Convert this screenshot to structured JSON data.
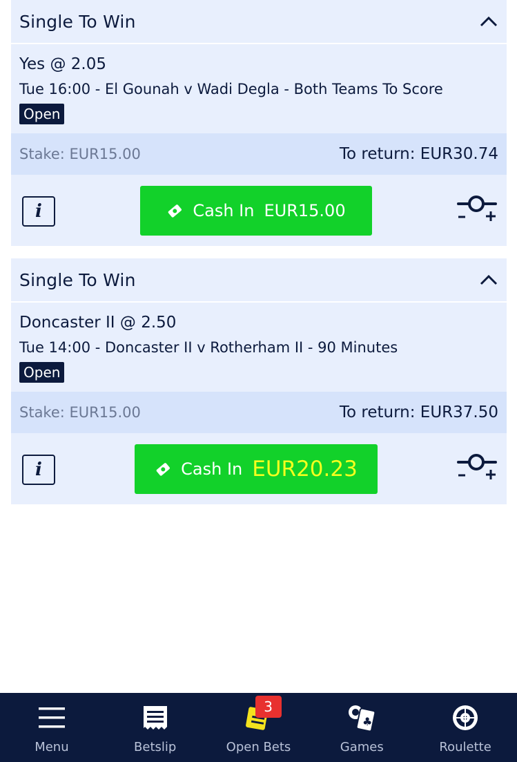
{
  "bets": [
    {
      "title": "Single To Win",
      "selection": "Yes @ 2.05",
      "event": "Tue 16:00 - El Gounah v Wadi Degla - Both Teams To Score",
      "status": "Open",
      "stake": "Stake: EUR15.00",
      "to_return": "To return: EUR30.74",
      "cash_in_label": "Cash In",
      "cash_in_amount": "EUR15.00"
    },
    {
      "title": "Single To Win",
      "selection": "Doncaster II @ 2.50",
      "event": "Tue 14:00 - Doncaster II v Rotherham II - 90 Minutes",
      "status": "Open",
      "stake": "Stake: EUR15.00",
      "to_return": "To return: EUR37.50",
      "cash_in_label": "Cash In",
      "cash_in_amount": "EUR20.23"
    }
  ],
  "info_label": "i",
  "nav": {
    "items": [
      {
        "label": "Menu",
        "icon": "hamburger-icon"
      },
      {
        "label": "Betslip",
        "icon": "receipt-icon"
      },
      {
        "label": "Open Bets",
        "icon": "open-bets-icon",
        "badge": "3"
      },
      {
        "label": "Games",
        "icon": "cards-icon"
      },
      {
        "label": "Roulette",
        "icon": "roulette-icon"
      }
    ]
  },
  "colors": {
    "navy": "#0c1a3d",
    "card_bg": "#e8effd",
    "stake_bg": "#d6e3fb",
    "cash_in_green": "#12d12a",
    "highlight_yellow": "#f4ff1e",
    "badge_red": "#e8312f"
  }
}
